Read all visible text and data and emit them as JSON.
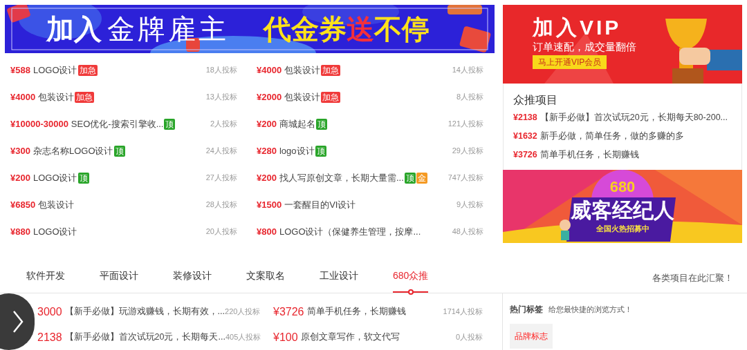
{
  "top_banner": {
    "kind": "picture",
    "title_bold": "加入",
    "title_light": "金牌雇主",
    "slogan_a": "代金券",
    "slogan_b": "送",
    "slogan_c": "不停"
  },
  "tasks": [
    {
      "price": "¥588",
      "title": "LOGO设计",
      "badges": [
        {
          "text": "加急",
          "kind": "urgent"
        }
      ],
      "bids": "18人投标"
    },
    {
      "price": "¥4000",
      "title": "包装设计",
      "badges": [
        {
          "text": "加急",
          "kind": "urgent"
        }
      ],
      "bids": "14人投标"
    },
    {
      "price": "¥4000",
      "title": "包装设计",
      "badges": [
        {
          "text": "加急",
          "kind": "urgent"
        }
      ],
      "bids": "13人投标"
    },
    {
      "price": "¥2000",
      "title": "包装设计",
      "badges": [
        {
          "text": "加急",
          "kind": "urgent"
        }
      ],
      "bids": "8人投标"
    },
    {
      "price": "¥10000-30000",
      "title": "SEO优化-搜索引擎收...",
      "badges": [
        {
          "text": "顶",
          "kind": "top"
        }
      ],
      "bids": "2人投标"
    },
    {
      "price": "¥200",
      "title": "商城起名",
      "badges": [
        {
          "text": "顶",
          "kind": "top"
        }
      ],
      "bids": "121人投标"
    },
    {
      "price": "¥300",
      "title": "杂志名称LOGO设计",
      "badges": [
        {
          "text": "顶",
          "kind": "top"
        }
      ],
      "bids": "24人投标"
    },
    {
      "price": "¥280",
      "title": "logo设计",
      "badges": [
        {
          "text": "顶",
          "kind": "top"
        }
      ],
      "bids": "29人投标"
    },
    {
      "price": "¥200",
      "title": "LOGO设计",
      "badges": [
        {
          "text": "顶",
          "kind": "top"
        }
      ],
      "bids": "27人投标"
    },
    {
      "price": "¥200",
      "title": "找人写原创文章，长期大量需...",
      "badges": [
        {
          "text": "顶",
          "kind": "top"
        },
        {
          "text": "金",
          "kind": "gold"
        }
      ],
      "bids": "747人投标"
    },
    {
      "price": "¥6850",
      "title": "包装设计",
      "bids": "28人投标"
    },
    {
      "price": "¥1500",
      "title": "一套醒目的VI设计",
      "bids": "9人投标"
    },
    {
      "price": "¥880",
      "title": "LOGO设计",
      "bids": "20人投标"
    },
    {
      "price": "¥800",
      "title": "LOGO设计（保健养生管理，按摩...",
      "bids": "48人投标"
    }
  ],
  "vip_banner": {
    "kind": "picture",
    "title": "加入VIP",
    "subtitle": "订单速配，成交量翻倍",
    "button": "马上开通VIP会员"
  },
  "crowd": {
    "title": "众推项目",
    "items": [
      {
        "price": "¥2138",
        "title": "【新手必做】首次试玩20元，长期每天80-200..."
      },
      {
        "price": "¥1632",
        "title": "新手必做，简单任务，做的多赚的多"
      },
      {
        "price": "¥3726",
        "title": "简单手机任务，长期赚钱"
      }
    ]
  },
  "agent_banner": {
    "kind": "picture",
    "number": "680",
    "title": "威客经纪人",
    "subtitle": "全国火热招募中"
  },
  "tabs": [
    {
      "label": "软件开发",
      "selected": false
    },
    {
      "label": "平面设计",
      "selected": false
    },
    {
      "label": "装修设计",
      "selected": false
    },
    {
      "label": "文案取名",
      "selected": false
    },
    {
      "label": "工业设计",
      "selected": false
    },
    {
      "label": "680众推",
      "selected": true
    }
  ],
  "tabs_note": "各类项目在此汇聚！",
  "bottom_tasks": [
    {
      "price": "3000",
      "title": "【新手必做】玩游戏赚钱，长期有效，...",
      "bids": "220人投标"
    },
    {
      "price": "¥3726",
      "title": "简单手机任务，长期赚钱",
      "bids": "1714人投标"
    },
    {
      "price": "2138",
      "title": "【新手必做】首次试玩20元，长期每天...",
      "bids": "405人投标"
    },
    {
      "price": "¥100",
      "title": "原创文章写作，软文代写",
      "bids": "0人投标"
    }
  ],
  "hot_tags": {
    "title": "热门标签",
    "hint": "给您最快捷的浏览方式！",
    "tags": [
      {
        "text": "品牌标志"
      }
    ]
  }
}
